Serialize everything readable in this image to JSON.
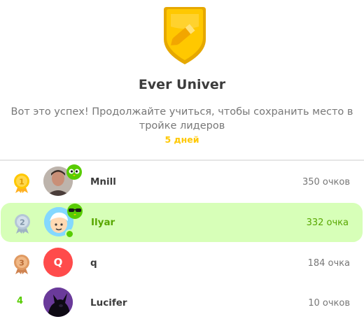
{
  "league": {
    "title": "Ever Univer",
    "message": "Вот это успех! Продолжайте учиться, чтобы сохранить место в тройке лидеров",
    "streak": "5 дней",
    "badge_icon": "pencil-shield-icon",
    "badge_color": "#ffc800"
  },
  "leaderboard": [
    {
      "rank": "1",
      "medal": "gold",
      "name": "Mnill",
      "points": "350 очков",
      "avatar": "photo",
      "highlighted": false
    },
    {
      "rank": "2",
      "medal": "silver",
      "name": "Ilyar",
      "points": "332 очка",
      "avatar": "cartoon",
      "highlighted": true
    },
    {
      "rank": "3",
      "medal": "bronze",
      "name": "q",
      "avatar_letter": "Q",
      "points": "184 очка",
      "avatar": "letter",
      "highlighted": false
    },
    {
      "rank": "4",
      "name": "Lucifer",
      "points": "10 очков",
      "avatar": "dark-character",
      "highlighted": false
    }
  ],
  "colors": {
    "highlight": "#d7ffb8",
    "accent_green": "#58cc02",
    "gold": "#ffc800",
    "silver": "#b4c6d6",
    "bronze": "#e09a62",
    "avatar_q": "#ff4b4b"
  }
}
